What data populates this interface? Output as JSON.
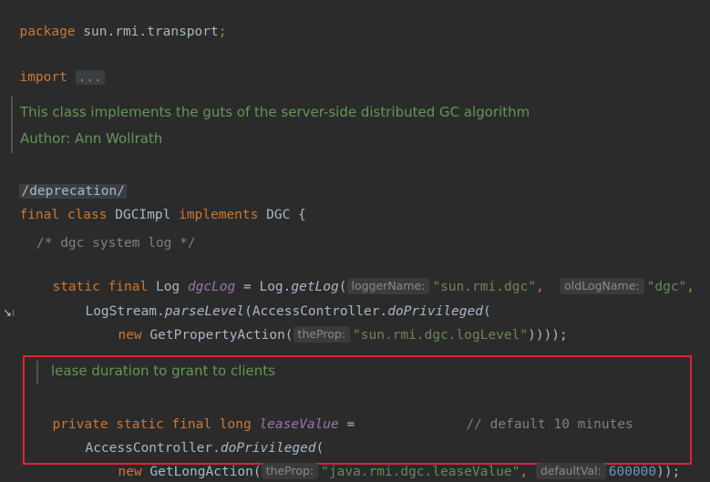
{
  "code": {
    "l1": {
      "kw": "package",
      "text": " sun.rmi.transport",
      "semi": ";"
    },
    "l2": {
      "kw": "import",
      "fold": "..."
    },
    "doc1": {
      "line1": "This class implements the guts of the server-side distributed GC algorithm",
      "line2": "Author: Ann Wollrath"
    },
    "deprecation": "/deprecation/",
    "classdecl": {
      "kw1": "final class",
      "name": " DGCImpl ",
      "kw2": "implements",
      "iface": " DGC {"
    },
    "comment1": "/* dgc system log */",
    "log": {
      "kw": "static final",
      "type": " Log ",
      "field": "dgcLog",
      "eq": " = Log.",
      "method": "getLog",
      "paren": "(",
      "hint1": "loggerName:",
      "str1": "\"sun.rmi.dgc\"",
      "comma": ",",
      "hint2": "oldLogName:",
      "str2": "\"dgc\"",
      "tail": ","
    },
    "logstream": {
      "pre": "LogStream.",
      "method": "parseLevel",
      "mid": "(AccessController.",
      "method2": "doPrivileged",
      "end": "("
    },
    "getprop": {
      "kw": "new",
      "cls": " GetPropertyAction(",
      "hint": "theProp:",
      "str": "\"sun.rmi.dgc.logLevel\"",
      "end": "))));"
    },
    "doc2": "lease duration to grant to clients",
    "lease": {
      "kw": "private static final long",
      "field": "leaseValue",
      "eq": " =",
      "comment": "// default 10 minutes"
    },
    "ac": {
      "pre": "AccessController.",
      "method": "doPrivileged",
      "end": "("
    },
    "getlong": {
      "kw": "new",
      "cls": " GetLongAction(",
      "hint1": "theProp:",
      "str": "\"java.rmi.dgc.leaseValue\"",
      "comma": ",",
      "hint2": "defaultVal:",
      "num": "600000",
      "end": "));"
    }
  },
  "icons": {
    "gutter": "navigate-implementation-icon"
  }
}
